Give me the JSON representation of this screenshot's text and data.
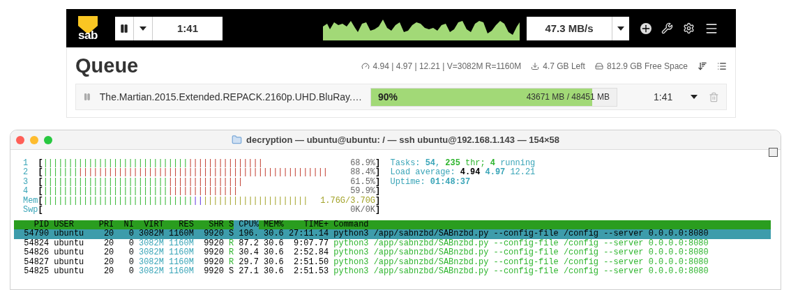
{
  "topbar": {
    "logo_text": "sab",
    "elapsed": "1:41",
    "speed": "47.3 MB/s"
  },
  "queue": {
    "title": "Queue",
    "stats": [
      {
        "kind": "load",
        "text": "4.94 | 4.97 | 12.21 | V=3082M R=1160M"
      },
      {
        "kind": "left",
        "text": "4.7 GB Left"
      },
      {
        "kind": "disk",
        "text": "812.9 GB Free Space"
      }
    ],
    "items": [
      {
        "name": "The.Martian.2015.Extended.REPACK.2160p.UHD.BluRay.…",
        "level": 0.9,
        "percent": "90%",
        "size": "43671 MB / 48451 MB",
        "eta": "1:41"
      }
    ]
  },
  "terminal": {
    "title": "decryption — ubuntu@ubuntu: / — ssh ubuntu@192.168.1.143 — 154×58",
    "meter_open": "[",
    "meter_close": "]",
    "meters": [
      {
        "label": "1",
        "kind": "cpu",
        "segments": [
          {
            "kind": "user",
            "text": "|||||||||||||||||||||||||||||"
          },
          {
            "kind": "system",
            "text": "|||||||||||||||"
          }
        ],
        "reading": "68.9%"
      },
      {
        "label": "2",
        "kind": "cpu",
        "segments": [
          {
            "kind": "user",
            "text": "|||||||"
          },
          {
            "kind": "system",
            "text": "||||||||||||||||||||||||||||||||||||||||||||||||||"
          }
        ],
        "reading": "88.4%"
      },
      {
        "label": "3",
        "kind": "cpu",
        "segments": [
          {
            "kind": "user",
            "text": "|||||||||||||||||||||||||"
          },
          {
            "kind": "system",
            "text": "|||||||||||||||"
          }
        ],
        "reading": "61.5%"
      },
      {
        "label": "4",
        "kind": "cpu",
        "segments": [
          {
            "kind": "user",
            "text": "|||||||||||||||||||||||||"
          },
          {
            "kind": "system",
            "text": "||||||||||||||"
          }
        ],
        "reading": "59.9%"
      },
      {
        "label": "Mem",
        "kind": "mem",
        "segments": [
          {
            "kind": "user",
            "text": "||||||||||||||||||||||||||||||"
          },
          {
            "kind": "buffers",
            "text": "||"
          },
          {
            "kind": "cache",
            "text": "|||||||||||||||||||||"
          }
        ],
        "reading": "1.76G/3.70G"
      },
      {
        "label": "Swp",
        "kind": "swap",
        "reading": "0K/0K"
      }
    ],
    "summary": [
      [
        {
          "kind": "label",
          "text": "Tasks: "
        },
        {
          "kind": "value",
          "text": "54"
        },
        {
          "kind": "label",
          "text": ", "
        },
        {
          "kind": "green",
          "text": "235"
        },
        {
          "kind": "greenlabel",
          "text": " thr; "
        },
        {
          "kind": "green",
          "text": "4"
        },
        {
          "kind": "label",
          "text": " running"
        }
      ],
      [
        {
          "kind": "label",
          "text": "Load average: "
        },
        {
          "kind": "strong",
          "text": "4.94"
        },
        {
          "kind": "value",
          "text": " 4.97"
        },
        {
          "kind": "label",
          "text": " 12.21"
        }
      ],
      [
        {
          "kind": "label",
          "text": "Uptime: "
        },
        {
          "kind": "value",
          "text": "01:48:37"
        }
      ]
    ],
    "columns": [
      {
        "label": "PID",
        "sorted": false
      },
      {
        "label": "USER",
        "sorted": false
      },
      {
        "label": "PRI",
        "sorted": false
      },
      {
        "label": "NI",
        "sorted": false
      },
      {
        "label": "VIRT",
        "sorted": false
      },
      {
        "label": "RES",
        "sorted": false
      },
      {
        "label": "SHR",
        "sorted": false
      },
      {
        "label": "S",
        "sorted": false
      },
      {
        "label": "CPU%",
        "sorted": true
      },
      {
        "label": "MEM%",
        "sorted": false
      },
      {
        "label": "TIME+",
        "sorted": false
      },
      {
        "label": "Command",
        "sorted": false
      }
    ],
    "rows": [
      {
        "selected": true,
        "running": false,
        "cells": [
          "54790",
          "ubuntu",
          "20",
          "0",
          "3082M",
          "1160M",
          "9920",
          "S",
          "196.",
          "30.6",
          "27:11.14",
          "python3 /app/sabnzbd/SABnzbd.py --config-file /config --server 0.0.0.0:8080"
        ]
      },
      {
        "selected": false,
        "running": true,
        "cells": [
          "54824",
          "ubuntu",
          "20",
          "0",
          "3082M",
          "1160M",
          "9920",
          "R",
          "87.2",
          "30.6",
          "9:07.77",
          "python3 /app/sabnzbd/SABnzbd.py --config-file /config --server 0.0.0.0:8080"
        ]
      },
      {
        "selected": false,
        "running": true,
        "cells": [
          "54826",
          "ubuntu",
          "20",
          "0",
          "3082M",
          "1160M",
          "9920",
          "R",
          "30.4",
          "30.6",
          "2:52.84",
          "python3 /app/sabnzbd/SABnzbd.py --config-file /config --server 0.0.0.0:8080"
        ]
      },
      {
        "selected": false,
        "running": true,
        "cells": [
          "54827",
          "ubuntu",
          "20",
          "0",
          "3082M",
          "1160M",
          "9920",
          "R",
          "29.7",
          "30.6",
          "2:51.50",
          "python3 /app/sabnzbd/SABnzbd.py --config-file /config --server 0.0.0.0:8080"
        ]
      },
      {
        "selected": false,
        "running": false,
        "cells": [
          "54825",
          "ubuntu",
          "20",
          "0",
          "3082M",
          "1160M",
          "9920",
          "S",
          "27.1",
          "30.6",
          "2:51.53",
          "python3 /app/sabnzbd/SABnzbd.py --config-file /config --server 0.0.0.0:8080"
        ]
      }
    ]
  }
}
